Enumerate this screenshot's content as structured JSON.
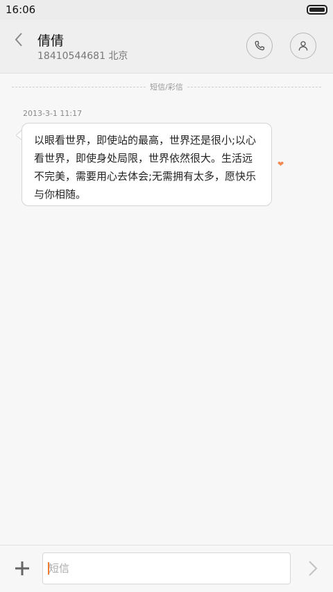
{
  "status_bar": {
    "time": "16:06"
  },
  "header": {
    "contact_name": "倩倩",
    "contact_detail": "18410544681 北京"
  },
  "thread": {
    "divider_label": "短信/彩信",
    "messages": [
      {
        "timestamp": "2013-3-1 11:17",
        "text": "以眼看世界，即使站的最高，世界还是很小;以心看世界，即使身处局限，世界依然很大。生活远不完美，需要用心去体会;无需拥有太多，愿快乐与你相随。"
      }
    ]
  },
  "composer": {
    "placeholder": "短信"
  },
  "colors": {
    "accent": "#f07a30",
    "heart": "#f08a50",
    "header_bg": "#efefef",
    "page_bg": "#f7f7f7"
  },
  "icons": [
    "back-chevron-icon",
    "phone-icon",
    "person-icon",
    "heart-icon",
    "plus-icon",
    "send-chevron-icon",
    "battery-icon"
  ]
}
